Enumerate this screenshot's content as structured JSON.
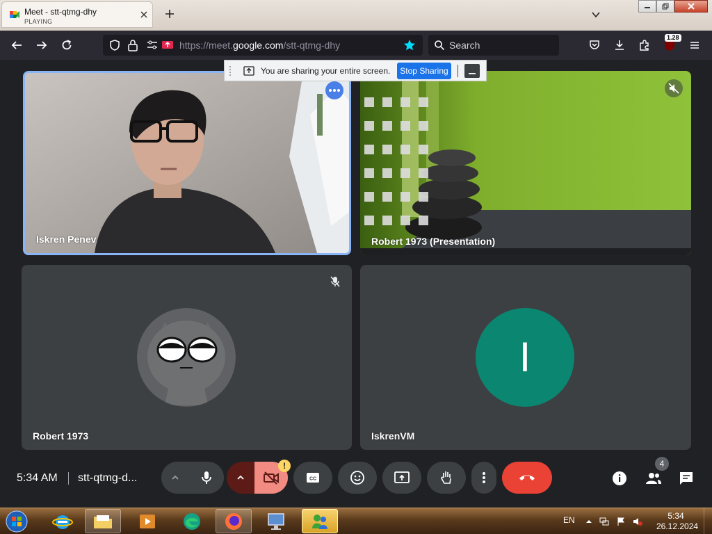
{
  "browser": {
    "tab": {
      "title": "Meet - stt-qtmg-dhy",
      "subtitle": "PLAYING"
    },
    "url": {
      "prefix": "https://meet.",
      "domain": "google.com",
      "path": "/stt-qtmg-dhy"
    },
    "search_placeholder": "Search",
    "extension_badge": "1.28"
  },
  "share_bar": {
    "message": "You are sharing your entire screen.",
    "stop_label": "Stop Sharing"
  },
  "tiles": [
    {
      "name": "Iskren Penev",
      "type": "camera"
    },
    {
      "name": "Robert 1973 (Presentation)",
      "type": "presentation"
    },
    {
      "name": "Robert 1973",
      "type": "avatar-image"
    },
    {
      "name": "IskrenVM",
      "type": "avatar-letter",
      "letter": "I",
      "avatar_color": "#0b8670"
    }
  ],
  "meet_bar": {
    "time": "5:34 AM",
    "separator": "|",
    "meeting_code": "stt-qtmg-d...",
    "warning_badge": "!",
    "people_count": "4"
  },
  "taskbar": {
    "language": "EN",
    "clock_time": "5:34",
    "clock_date": "26.12.2024"
  },
  "colors": {
    "meet_bg": "#202124",
    "tile_bg": "#3c4043",
    "active_border": "#8ab4f8",
    "end_call": "#ea4335",
    "camera_off": "#5c1b17",
    "accent_blue": "#1a73e8"
  }
}
